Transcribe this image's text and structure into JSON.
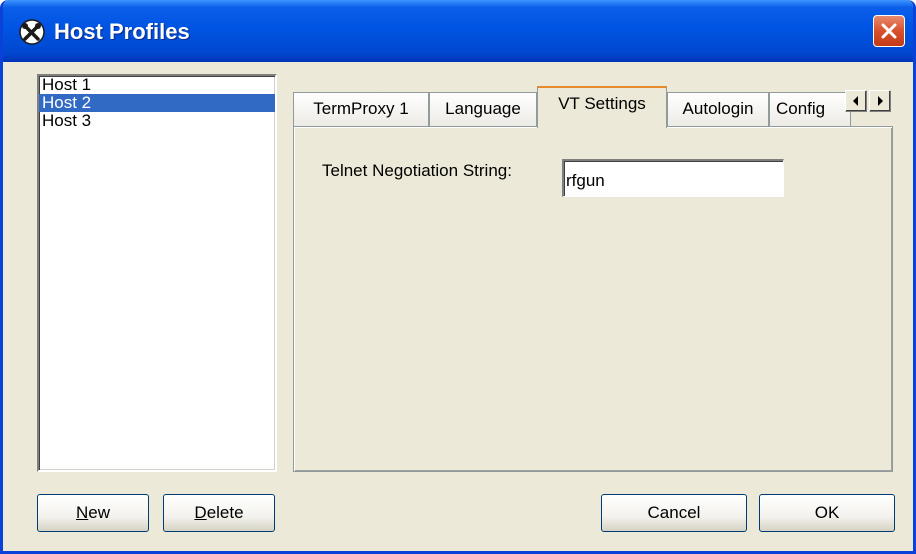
{
  "window": {
    "title": "Host Profiles",
    "app_icon": "tools-icon",
    "close_icon": "close-icon",
    "colors": {
      "titlebar": "#0054E3",
      "close": "#D9502C",
      "body": "#ECE9D8",
      "selection": "#316AC5"
    }
  },
  "hosts": {
    "items": [
      "Host 1",
      "Host 2",
      "Host 3"
    ],
    "selected": "Host 2"
  },
  "tabs": {
    "items": [
      {
        "label": "TermProxy 1"
      },
      {
        "label": "Language"
      },
      {
        "label": "VT Settings"
      },
      {
        "label": "Autologin"
      },
      {
        "label": "Config"
      }
    ],
    "active": "VT Settings",
    "scroll_left_icon": "arrow-left-icon",
    "scroll_right_icon": "arrow-right-icon"
  },
  "vt_settings": {
    "telnet_label": "Telnet Negotiation String:",
    "telnet_value": "rfgun"
  },
  "buttons": {
    "new": {
      "mnemonic": "N",
      "rest": "ew"
    },
    "delete": {
      "mnemonic": "D",
      "rest": "elete"
    },
    "cancel": "Cancel",
    "ok": "OK"
  }
}
